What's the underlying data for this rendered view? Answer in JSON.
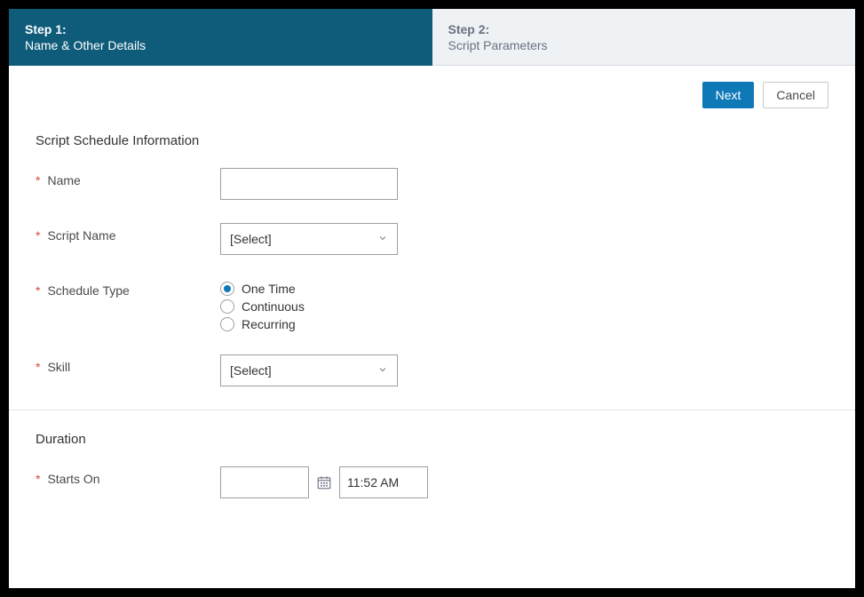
{
  "steps": {
    "step1": {
      "num": "Step 1:",
      "label": "Name & Other Details"
    },
    "step2": {
      "num": "Step 2:",
      "label": "Script Parameters"
    }
  },
  "toolbar": {
    "next_label": "Next",
    "cancel_label": "Cancel"
  },
  "section1": {
    "title": "Script Schedule Information",
    "name_label": "Name",
    "name_value": "",
    "script_name_label": "Script Name",
    "script_name_value": "[Select]",
    "schedule_type_label": "Schedule Type",
    "schedule_options": {
      "one_time": "One Time",
      "continuous": "Continuous",
      "recurring": "Recurring"
    },
    "skill_label": "Skill",
    "skill_value": "[Select]"
  },
  "section2": {
    "title": "Duration",
    "starts_on_label": "Starts On",
    "date_value": "",
    "time_value": "11:52 AM"
  }
}
